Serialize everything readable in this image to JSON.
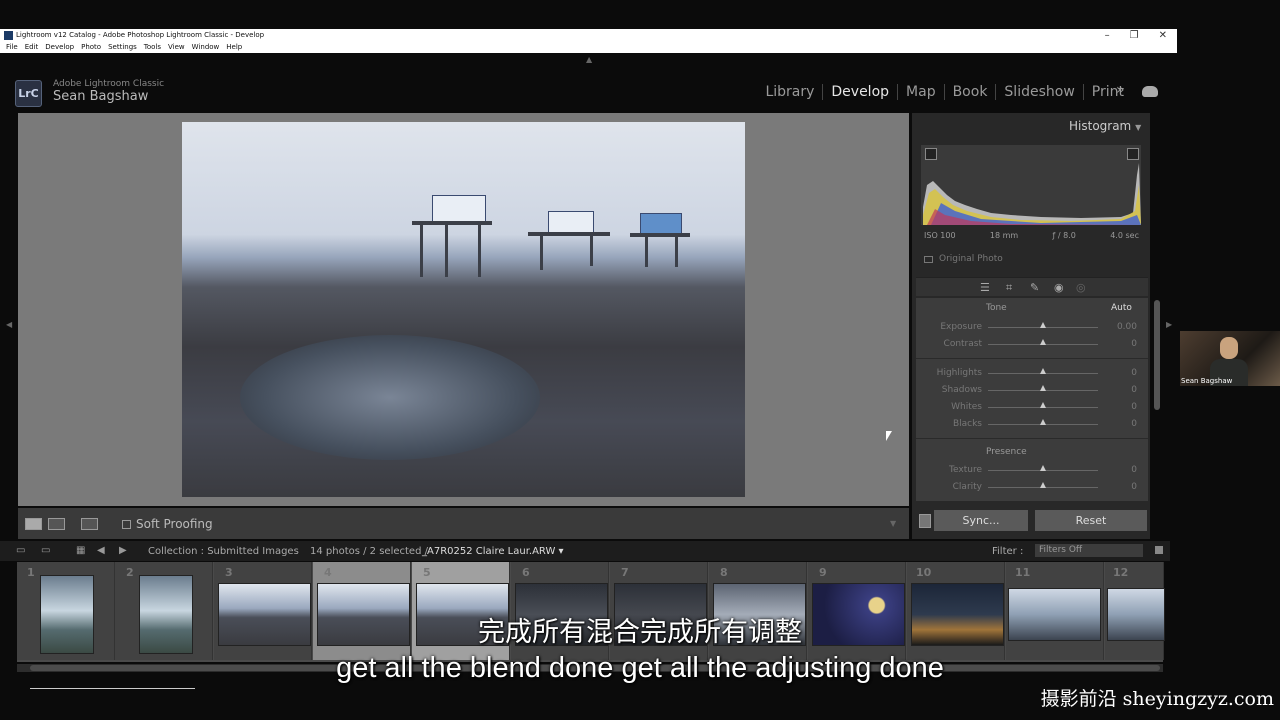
{
  "window": {
    "title": "Lightroom v12 Catalog - Adobe Photoshop Lightroom Classic - Develop",
    "menu": [
      "File",
      "Edit",
      "Develop",
      "Photo",
      "Settings",
      "Tools",
      "View",
      "Window",
      "Help"
    ],
    "controls": [
      "–",
      "❐",
      "✕"
    ]
  },
  "identity": {
    "logo": "LrC",
    "app_name": "Adobe Lightroom Classic",
    "user": "Sean Bagshaw"
  },
  "modules": [
    "Library",
    "Develop",
    "Map",
    "Book",
    "Slideshow",
    "Print"
  ],
  "active_module": "Develop",
  "module_more": "»",
  "toolbar": {
    "soft_proofing": "Soft Proofing"
  },
  "histogram": {
    "title": "Histogram",
    "iso": "ISO 100",
    "focal": "18 mm",
    "aperture": "ƒ / 8.0",
    "shutter": "4.0 sec",
    "original_photo": "Original Photo"
  },
  "basic": {
    "tone_label": "Tone",
    "auto_label": "Auto",
    "presence_label": "Presence",
    "sliders": [
      {
        "label": "Exposure",
        "value": "0.00"
      },
      {
        "label": "Contrast",
        "value": "0"
      },
      {
        "label": "Highlights",
        "value": "0"
      },
      {
        "label": "Shadows",
        "value": "0"
      },
      {
        "label": "Whites",
        "value": "0"
      },
      {
        "label": "Blacks",
        "value": "0"
      },
      {
        "label": "Texture",
        "value": "0"
      },
      {
        "label": "Clarity",
        "value": "0"
      }
    ]
  },
  "buttons": {
    "sync": "Sync...",
    "reset": "Reset"
  },
  "filmstrip_bar": {
    "collection": "Collection : Submitted Images",
    "count": "14 photos / 2 selected /",
    "filename": "_A7R0252 Claire Laur.ARW ▾",
    "filter_label": "Filter :",
    "filter_value": "Filters Off"
  },
  "filmstrip": {
    "numbers": [
      "1",
      "2",
      "3",
      "4",
      "5",
      "6",
      "7",
      "8",
      "9",
      "10",
      "11",
      "12"
    ]
  },
  "webcam": {
    "name": "Sean Bagshaw"
  },
  "subtitles": {
    "chinese": "完成所有混合完成所有调整",
    "english": "get all the blend done get all the adjusting done"
  },
  "watermark": "摄影前沿 sheyingzyz.com"
}
